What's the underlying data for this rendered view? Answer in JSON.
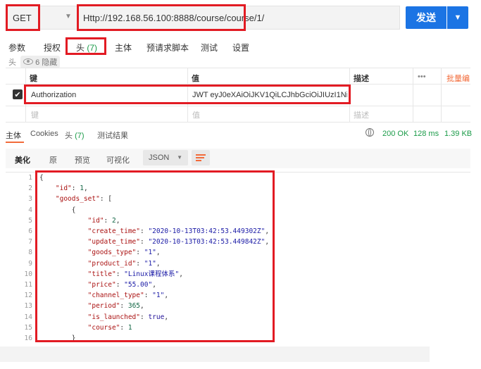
{
  "request": {
    "method": "GET",
    "url": "Http://192.168.56.100:8888/course/course/1/",
    "send_label": "发送"
  },
  "request_tabs": {
    "params": "参数",
    "auth": "授权",
    "headers": "头",
    "headers_count": "(7)",
    "body": "主体",
    "prerequest": "预请求脚本",
    "tests": "测试",
    "settings": "设置"
  },
  "hidden_row": {
    "label": "头",
    "hidden_text": "6 隐藏"
  },
  "headers_table": {
    "col_key": "键",
    "col_value": "值",
    "col_desc": "描述",
    "more": "•••",
    "bulk_edit": "批量编",
    "rows": [
      {
        "key": "Authorization",
        "value": "JWT eyJ0eXAiOiJKV1QiLCJhbGciOiJIUzI1NiJ9.e..."
      }
    ],
    "placeholder_key": "键",
    "placeholder_value": "值",
    "placeholder_desc": "描述"
  },
  "response_tabs": {
    "body": "主体",
    "cookies": "Cookies",
    "headers": "头",
    "headers_count": "(7)",
    "test_results": "测试结果"
  },
  "response_status": {
    "status": "200 OK",
    "time": "128 ms",
    "size": "1.39 KB"
  },
  "body_toolbar": {
    "pretty": "美化",
    "raw": "原",
    "preview": "预览",
    "visualize": "可视化",
    "format": "JSON"
  },
  "code_lines": [
    "1",
    "2",
    "3",
    "4",
    "5",
    "6",
    "7",
    "8",
    "9",
    "10",
    "11",
    "12",
    "13",
    "14",
    "15",
    "16"
  ],
  "json_body": {
    "l1": "{",
    "l2_key": "\"id\"",
    "l2_val": "1",
    "l3_key": "\"goods_set\"",
    "l3_rest": ": [",
    "l4": "{",
    "l5_key": "\"id\"",
    "l5_val": "2",
    "l6_key": "\"create_time\"",
    "l6_val": "\"2020-10-13T03:42:53.449302Z\"",
    "l7_key": "\"update_time\"",
    "l7_val": "\"2020-10-13T03:42:53.449842Z\"",
    "l8_key": "\"goods_type\"",
    "l8_val": "\"1\"",
    "l9_key": "\"product_id\"",
    "l9_val": "\"1\"",
    "l10_key": "\"title\"",
    "l10_val": "\"Linux课程体系\"",
    "l11_key": "\"price\"",
    "l11_val": "\"55.00\"",
    "l12_key": "\"channel_type\"",
    "l12_val": "\"1\"",
    "l13_key": "\"period\"",
    "l13_val": "365",
    "l14_key": "\"is_launched\"",
    "l14_val": "true",
    "l15_key": "\"course\"",
    "l15_val": "1",
    "l16": "}"
  },
  "colors": {
    "accent_blue": "#1b74e4",
    "highlight_red": "#e21b23",
    "status_green": "#1a9b48",
    "orange": "#f26b3a"
  }
}
